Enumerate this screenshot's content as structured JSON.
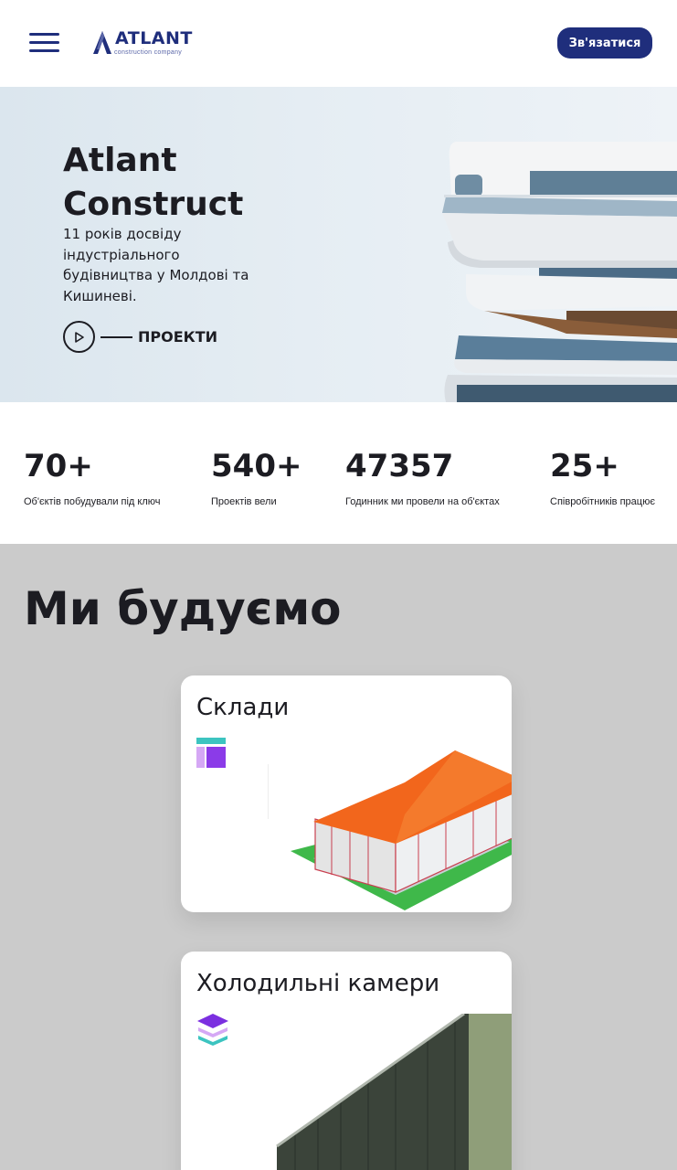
{
  "header": {
    "logo_name": "ATLANT",
    "logo_sub": "construction company",
    "contact_label": "Зв'язатися",
    "brand_color": "#1f2e7c"
  },
  "hero": {
    "title": "Atlant\nConstruct",
    "subtitle": "11 років досвіду індустріального будівництва у Молдові та Кишиневі.",
    "projects_label": "ПРОЕКТИ"
  },
  "stats": [
    {
      "value": "70+",
      "label": "Об'єктів побудували під ключ"
    },
    {
      "value": "540+",
      "label": "Проектів вели"
    },
    {
      "value": "47357",
      "label": "Годинник ми провели на об'єктах"
    },
    {
      "value": "25+",
      "label": "Співробітників працює"
    }
  ],
  "services": {
    "title": "Ми будуємо",
    "cards": [
      {
        "title": "Склади",
        "icon": "layout-icon"
      },
      {
        "title": "Холодильні камери",
        "icon": "layers-icon"
      }
    ]
  }
}
